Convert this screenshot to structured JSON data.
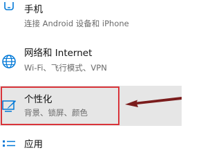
{
  "settings": {
    "items": [
      {
        "title": "手机",
        "desc": "连接 Android 设备和 iPhone",
        "icon": "phone-icon"
      },
      {
        "title": "网络和 Internet",
        "desc": "Wi-Fi、飞行模式、VPN",
        "icon": "globe-icon"
      },
      {
        "title": "个性化",
        "desc": "背景、锁屏、颜色",
        "icon": "personalization-icon"
      },
      {
        "title": "应用",
        "icon": "apps-icon"
      }
    ]
  },
  "colors": {
    "accent": "#0078d7",
    "annotation": "#d9343a",
    "selected_background": "#e6e6e6"
  }
}
